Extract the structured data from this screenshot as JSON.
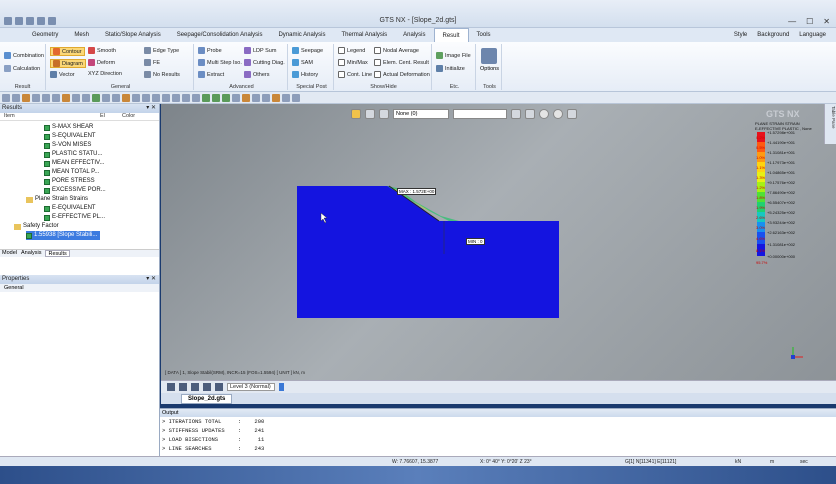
{
  "title": "GTS NX - [Slope_2d.gts]",
  "menu": {
    "tabs": [
      "Geometry",
      "Mesh",
      "Static/Slope Analysis",
      "Seepage/Consolidation Analysis",
      "Dynamic Analysis",
      "Thermal Analysis",
      "Analysis",
      "Result",
      "Tools"
    ],
    "right": [
      "Style",
      "Background",
      "Language"
    ]
  },
  "ribbon": {
    "result_group": {
      "combination": "Combination",
      "calculation": "Calculation",
      "label": "Result"
    },
    "general_group": {
      "contour": "Contour",
      "diagram": "Diagram",
      "vector": "Vector",
      "smooth": "Smooth",
      "deform": "Deform",
      "xyz_direction": "XYZ Direction",
      "edge_type": "Edge Type",
      "fe": "FE",
      "no_results": "No Results",
      "label": "General"
    },
    "advanced_group": {
      "probe": "Probe",
      "multi_step": "Multi Step Iso.",
      "extract": "Extract",
      "ldp_sum": "LDP Sum",
      "cutting_diag": "Cutting Diag.",
      "others": "Others",
      "label": "Advanced"
    },
    "special_group": {
      "seepage": "Seepage",
      "sam": "SAM",
      "history": "History",
      "label": "Special Post"
    },
    "showhide_group": {
      "legend": "Legend",
      "min_max": "Min/Max",
      "cont_line": "Cont. Line",
      "nodal_avg": "Nodal Average",
      "elem_cent": "Elem. Cent. Result",
      "actual_def": "Actual Deformation",
      "label": "Show/Hide"
    },
    "etc_group": {
      "image_file": "Image File",
      "initialize": "Initialize",
      "label": "Etc."
    },
    "tools_group": {
      "options": "Options",
      "label": "Tools"
    }
  },
  "results_panel": {
    "title": "Results",
    "columns": [
      "Item",
      "El",
      "Color"
    ],
    "nodes": [
      "S-MAX SHEAR",
      "S-EQUIVALENT",
      "S-VON MISES",
      "PLASTIC STATU...",
      "MEAN EFFECTIV...",
      "MEAN TOTAL P...",
      "PORE STRESS",
      "EXCESSIVE POR..."
    ],
    "plane_strain": "Plane Strain Strains",
    "strain_nodes": [
      "E-EQUIVALENT",
      "E-EFFECTIVE PL..."
    ],
    "safety_factor": "Safety Factor",
    "selected_node": "1.55938 [Slope Stabili...",
    "tabs": [
      "Model",
      "Analysis",
      "Results"
    ]
  },
  "properties_panel": {
    "title": "Properties",
    "general": "General"
  },
  "viewport": {
    "view_select": "None (0)",
    "max_label": "MAX : 1.572E+00",
    "min_label": "MIN : 0",
    "info_line": "[ DATA ]  1, Slope Stabil(SRM), INCR=15 (FOS=1.5594)  [ UNIT ]  kN, m",
    "legend_title": "PLANE STRAIN STRAIN\nE-EFFECTIVE PLASTIC , None",
    "legend_values": [
      "+1.57298e+001",
      "+1.44190e+001",
      "+1.31081e+001",
      "+1.17973e+001",
      "+1.04865e+001",
      "+9.17576e+002",
      "+7.86490e+002",
      "+6.55407e+002",
      "+5.24325e+002",
      "+3.93244e+002",
      "+2.62163e+002",
      "+1.31081e+002",
      "+0.00000e+000"
    ],
    "legend_pcts": [
      "0.2%",
      "0.5%",
      "1.0%",
      "1.1%",
      "1.3%",
      "1.2%",
      "1.8%",
      "1.9%",
      "2.6%",
      "3.0%",
      "4.6%",
      "8.1%",
      "95.7%"
    ],
    "brand": "GTS NX"
  },
  "timeline": {
    "level": "Level 3 (Normal)"
  },
  "doc_tab": "Slope_2d.gts",
  "output": {
    "title": "Output",
    "lines": [
      "> ITERATIONS TOTAL     :    200",
      "> STIFFNESS UPDATES    :    241",
      "> LOAD BISECTIONS      :     11",
      "> LINE SEARCHES        :    243"
    ]
  },
  "statusbar": {
    "coords": "W: 7.76607, 15.3877",
    "angles": "X: 0°  40° Y: 0°20'  Z 23°",
    "counts": "G[1] N[11341] E[11121]",
    "unit_force": "kN",
    "unit_len": "m",
    "unit_time": "sec"
  },
  "right_strip": "Table Pane"
}
